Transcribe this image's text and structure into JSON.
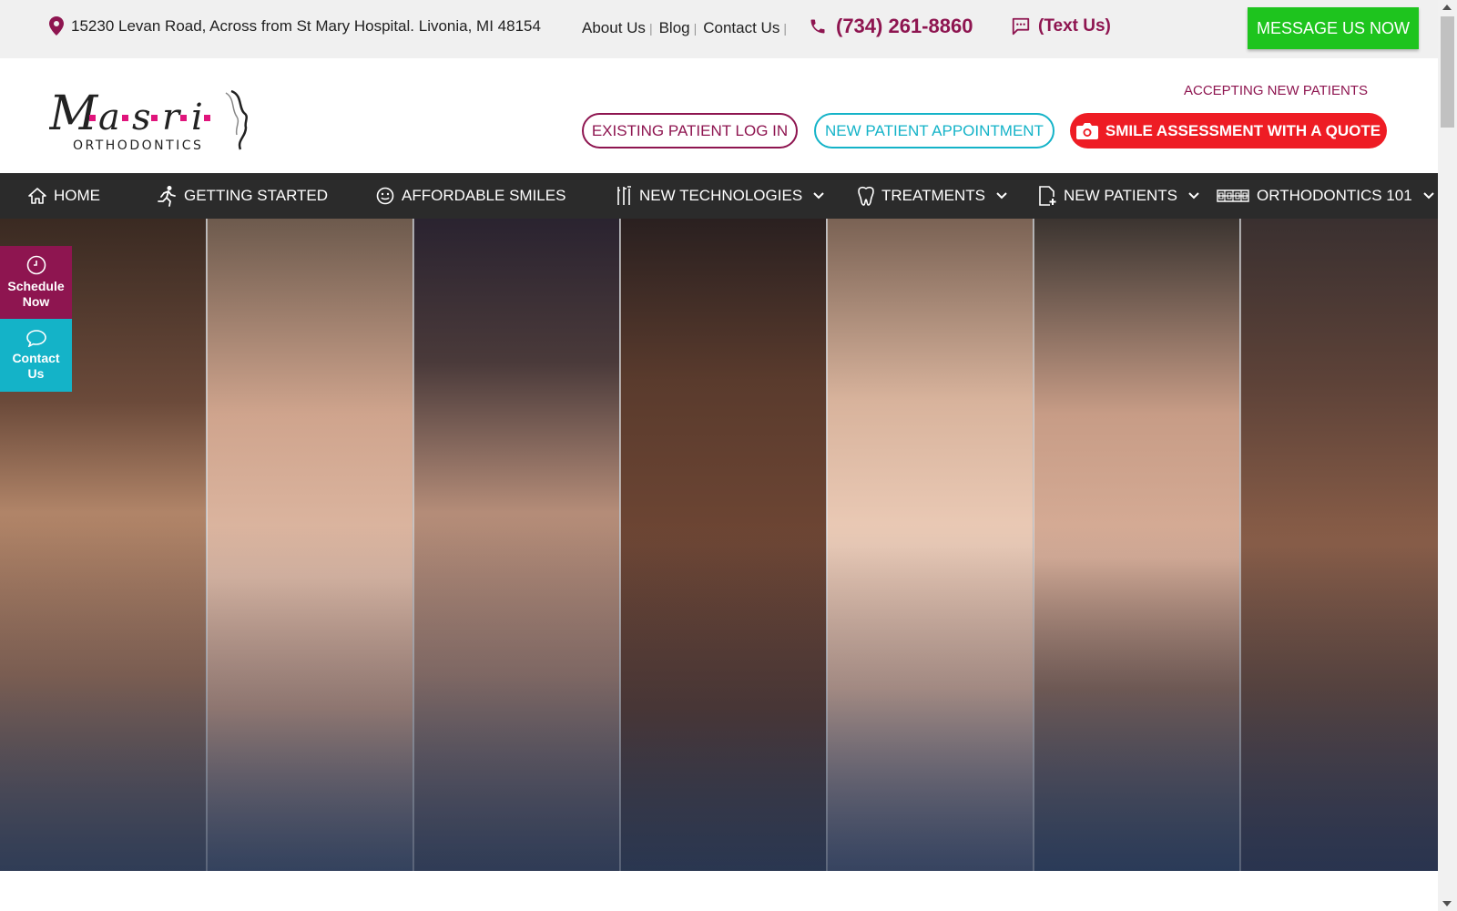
{
  "topbar": {
    "address": "15230 Levan Road, Across from St Mary Hospital. Livonia, MI 48154",
    "links": [
      "About Us",
      "Blog",
      "Contact Us"
    ],
    "phone": "(734) 261-8860",
    "text_us": "(Text Us)",
    "message_button": "MESSAGE US NOW"
  },
  "header": {
    "logo_text": "M a s r i",
    "logo_sub": "ORTHODONTICS",
    "accepting": "ACCEPTING NEW PATIENTS",
    "existing_patient": "EXISTING PATIENT LOG IN",
    "new_patient_appt": "NEW PATIENT APPOINTMENT",
    "smile_assessment": "SMILE ASSESSMENT WITH A QUOTE"
  },
  "nav": {
    "items": [
      {
        "label": "HOME",
        "icon": "home-icon"
      },
      {
        "label": "GETTING STARTED",
        "icon": "running-person-icon"
      },
      {
        "label": "AFFORDABLE SMILES",
        "icon": "smiley-icon"
      },
      {
        "label": "NEW TECHNOLOGIES",
        "icon": "dental-tools-icon"
      },
      {
        "label": "TREATMENTS",
        "icon": "tooth-icon"
      },
      {
        "label": "NEW PATIENTS",
        "icon": "add-file-icon"
      },
      {
        "label": "ORTHODONTICS 101",
        "icon": "braces-icon"
      }
    ]
  },
  "side": {
    "schedule_line1": "Schedule",
    "schedule_line2": "Now",
    "contact_line1": "Contact",
    "contact_line2": "Us"
  },
  "colors": {
    "brand": "#8e1550",
    "teal": "#14b3c8",
    "red": "#ee1c24",
    "green": "#1ec41e",
    "nav_bg": "#2b2b2b"
  }
}
